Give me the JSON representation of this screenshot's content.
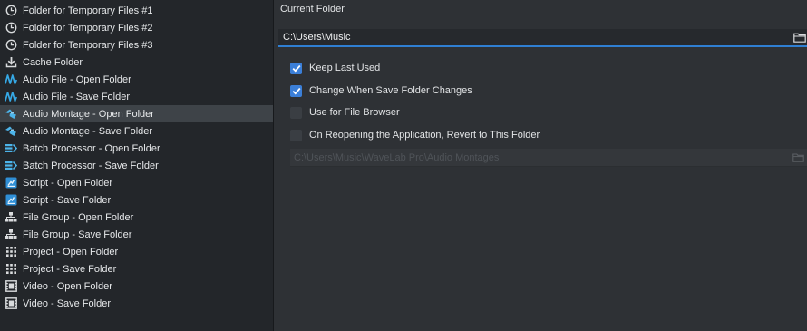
{
  "folder_list": [
    {
      "label": "Folder for Temporary Files #1",
      "icon": "clock-icon"
    },
    {
      "label": "Folder for Temporary Files #2",
      "icon": "clock-icon"
    },
    {
      "label": "Folder for Temporary Files #3",
      "icon": "clock-icon"
    },
    {
      "label": "Cache Folder",
      "icon": "download-icon"
    },
    {
      "label": "Audio File - Open Folder",
      "icon": "waveform-icon"
    },
    {
      "label": "Audio File - Save Folder",
      "icon": "waveform-icon"
    },
    {
      "label": "Audio Montage - Open Folder",
      "icon": "montage-icon"
    },
    {
      "label": "Audio Montage - Save Folder",
      "icon": "montage-icon"
    },
    {
      "label": "Batch Processor - Open Folder",
      "icon": "batch-processor-icon"
    },
    {
      "label": "Batch Processor - Save Folder",
      "icon": "batch-processor-icon"
    },
    {
      "label": "Script - Open Folder",
      "icon": "script-icon"
    },
    {
      "label": "Script - Save Folder",
      "icon": "script-icon"
    },
    {
      "label": "File Group - Open Folder",
      "icon": "file-group-icon"
    },
    {
      "label": "File Group - Save Folder",
      "icon": "file-group-icon"
    },
    {
      "label": "Project - Open Folder",
      "icon": "project-grid-icon"
    },
    {
      "label": "Project - Save Folder",
      "icon": "project-grid-icon"
    },
    {
      "label": "Video - Open Folder",
      "icon": "video-icon"
    },
    {
      "label": "Video - Save Folder",
      "icon": "video-icon"
    }
  ],
  "selected_index": 6,
  "current_folder": {
    "label": "Current Folder",
    "path": "C:\\Users\\Music"
  },
  "options": {
    "keep_last_used": {
      "label": "Keep Last Used",
      "checked": true
    },
    "change_when_save": {
      "label": "Change When Save Folder Changes",
      "checked": true
    },
    "use_for_file_browser": {
      "label": "Use for File Browser",
      "checked": false
    },
    "revert_on_reopen": {
      "label": "On Reopening the Application, Revert to This Folder",
      "checked": false
    }
  },
  "revert_path": "C:\\Users\\Music\\WaveLab Pro\\Audio Montages",
  "colors": {
    "accent": "#3b7fd8",
    "selection": "#3e4348",
    "list_bg": "#23262a",
    "panel_bg": "#2e3135"
  }
}
